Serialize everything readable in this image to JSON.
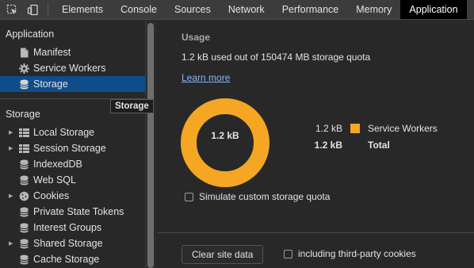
{
  "toolbar": {
    "tabs": [
      {
        "label": "Elements"
      },
      {
        "label": "Console"
      },
      {
        "label": "Sources"
      },
      {
        "label": "Network"
      },
      {
        "label": "Performance"
      },
      {
        "label": "Memory"
      },
      {
        "label": "Application",
        "active": true
      }
    ]
  },
  "sidebar": {
    "application_header": "Application",
    "application_items": [
      {
        "label": "Manifest",
        "icon": "file-icon"
      },
      {
        "label": "Service Workers",
        "icon": "gear-icon"
      },
      {
        "label": "Storage",
        "icon": "database-icon",
        "selected": true
      }
    ],
    "storage_header": "Storage",
    "storage_items": [
      {
        "label": "Local Storage",
        "icon": "grid-icon",
        "expandable": true
      },
      {
        "label": "Session Storage",
        "icon": "grid-icon",
        "expandable": true
      },
      {
        "label": "IndexedDB",
        "icon": "database-icon",
        "expandable": false
      },
      {
        "label": "Web SQL",
        "icon": "database-icon",
        "expandable": false
      },
      {
        "label": "Cookies",
        "icon": "cookie-icon",
        "expandable": true
      },
      {
        "label": "Private State Tokens",
        "icon": "database-icon",
        "expandable": false
      },
      {
        "label": "Interest Groups",
        "icon": "database-icon",
        "expandable": false
      },
      {
        "label": "Shared Storage",
        "icon": "database-icon",
        "expandable": true
      },
      {
        "label": "Cache Storage",
        "icon": "database-icon",
        "expandable": false
      }
    ]
  },
  "tooltip": "Storage",
  "main": {
    "usage_title": "Usage",
    "usage_text": "1.2 kB used out of 150474 MB storage quota",
    "learn_more": "Learn more",
    "donut_label": "1.2 kB",
    "donut_fraction": 1.0,
    "legend": [
      {
        "amount": "1.2 kB",
        "name": "Service Workers",
        "color": "#f5a623",
        "bold": false
      },
      {
        "amount": "1.2 kB",
        "name": "Total",
        "bold": true
      }
    ],
    "simulate_label": "Simulate custom storage quota",
    "clear_button": "Clear site data",
    "third_party_label": "including third-party cookies"
  },
  "colors": {
    "accent": "#f5a623",
    "selection": "#0f4d8a",
    "link": "#8ab4f8"
  }
}
